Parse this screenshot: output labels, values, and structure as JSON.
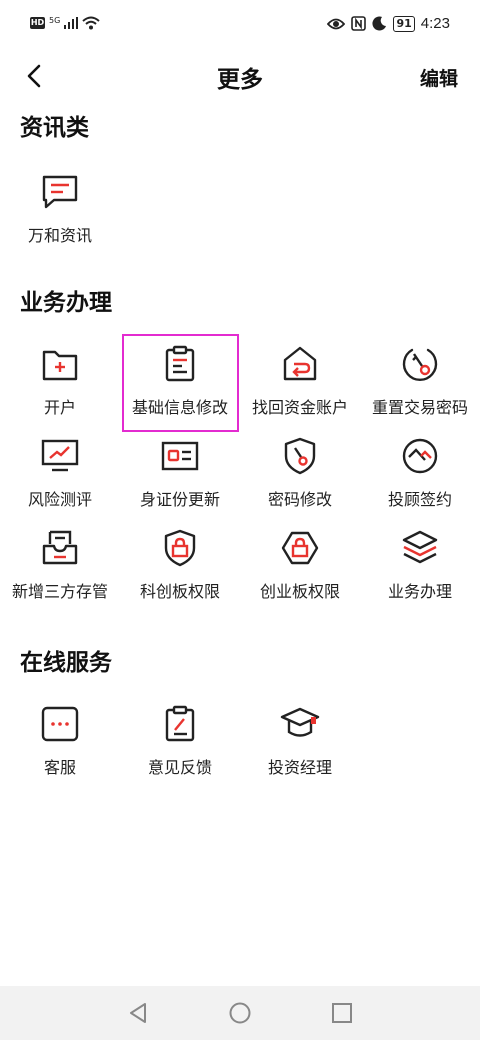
{
  "status_bar": {
    "network": "5G",
    "battery": "91",
    "time": "4:23",
    "icons": [
      "hd-icon",
      "signal-icon",
      "wifi-icon",
      "eye-icon",
      "nfc-icon",
      "moon-icon",
      "battery-icon"
    ]
  },
  "header": {
    "title": "更多",
    "edit_label": "编辑",
    "back_icon": "chevron-left-icon"
  },
  "sections": {
    "info": {
      "title": "资讯类",
      "items": [
        {
          "label": "万和资讯",
          "icon": "message-icon"
        }
      ]
    },
    "business": {
      "title": "业务办理",
      "items": [
        {
          "label": "开户",
          "icon": "folder-plus-icon"
        },
        {
          "label": "基础信息修改",
          "icon": "clipboard-icon"
        },
        {
          "label": "找回资金账户",
          "icon": "home-return-icon"
        },
        {
          "label": "重置交易密码",
          "icon": "key-circle-icon"
        },
        {
          "label": "风险测评",
          "icon": "monitor-chart-icon"
        },
        {
          "label": "身证份更新",
          "icon": "id-card-icon"
        },
        {
          "label": "密码修改",
          "icon": "shield-key-icon"
        },
        {
          "label": "投顾签约",
          "icon": "sign-circle-icon"
        },
        {
          "label": "新增三方存管",
          "icon": "inbox-icon"
        },
        {
          "label": "科创板权限",
          "icon": "shield-lock-icon"
        },
        {
          "label": "创业板权限",
          "icon": "hexagon-lock-icon"
        },
        {
          "label": "业务办理",
          "icon": "layers-icon"
        }
      ]
    },
    "online": {
      "title": "在线服务",
      "items": [
        {
          "label": "客服",
          "icon": "chat-dots-icon"
        },
        {
          "label": "意见反馈",
          "icon": "clipboard-pen-icon"
        },
        {
          "label": "投资经理",
          "icon": "graduation-cap-icon"
        }
      ]
    }
  },
  "colors": {
    "accent": "#e8342f",
    "icon_stroke": "#222222",
    "highlight": "#e32bd0"
  },
  "nav_bar": {
    "icons": [
      "back-triangle-icon",
      "home-circle-icon",
      "recents-square-icon"
    ]
  }
}
